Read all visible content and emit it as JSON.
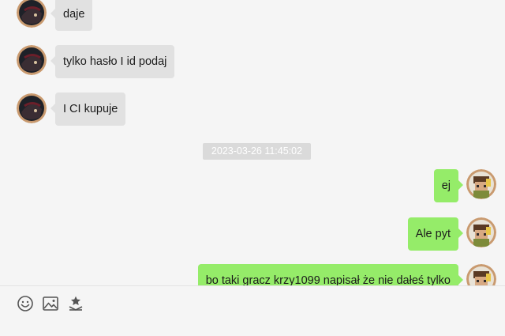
{
  "colors": {
    "background": "#f5f5f5",
    "incoming_bubble": "#e1e1e1",
    "outgoing_bubble": "#95ec69",
    "timestamp_bg": "#dadada",
    "icon": "#555555"
  },
  "messages": [
    {
      "direction": "incoming",
      "text": "daje"
    },
    {
      "direction": "incoming",
      "text": "tylko hasło I id podaj"
    },
    {
      "direction": "incoming",
      "text": "I CI kupuje"
    },
    {
      "direction": "outgoing",
      "text": "ej"
    },
    {
      "direction": "outgoing",
      "text": "Ale pyt"
    },
    {
      "direction": "outgoing",
      "text": "bo taki gracz krzy1099 napisał że nie dałeś tylko"
    }
  ],
  "timestamp": "2023-03-26 11:45:02",
  "toolbar": {
    "icons": [
      "emoji-icon",
      "image-icon",
      "gift-icon"
    ]
  }
}
